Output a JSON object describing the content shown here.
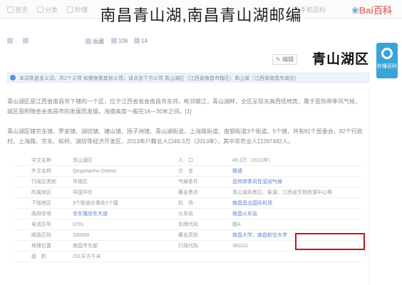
{
  "overlay_title": "南昌青山湖,南昌青山湖邮编",
  "topbar": {
    "items": [
      "首页",
      "分类",
      "秒懂",
      "特色",
      "用户",
      "权威合作",
      "手机百科"
    ],
    "logo": "Bai百科"
  },
  "subbar": {
    "items": [
      "收藏",
      "106",
      "14"
    ]
  },
  "float_button": {
    "label": "秒懂百科"
  },
  "entry": {
    "title": "青山湖区",
    "edit_label": "编辑"
  },
  "notice": {
    "text": "本词条是多义词，共2个义项 如需查看其他义项，请点击下方义项 青山湖区（江西省南昌市辖区）青山湖（江西省南昌市湖泊）"
  },
  "paragraphs": [
    {
      "text": "青山湖区是江西省南昌市下辖的一个区，位于江西省省会南昌市东郊，毗邻赣江，青山湖畔，全区呈现东高西低地势，属于亚热带季风气候，城区面积随省会南昌市的发展而发展，海拔高度一般在16—30米之间。[1]"
    },
    {
      "text": "青山湖区辖京东镇、罗家镇、湖坊镇、塘山镇、扬子洲镇、青山湖街道、上海路街道、南钢街道3个街道、5个镇，共有81个居委会，82个行政村。上海路、京东、蛟桥、湖坊等经济开发区，2013年户籍总人口49.3万（2013年），其中非农业人口267482人。"
    }
  ],
  "table": {
    "rows": [
      [
        "中文名称",
        "青山湖区",
        "人　口",
        "49.3万（2013年）"
      ],
      [
        "外文名称",
        "Qingshanhu District",
        "方　言",
        "赣语"
      ],
      [
        "行政区类别",
        "市辖区",
        "气候条件",
        "亚热带季风性湿润气候"
      ],
      [
        "所属地区",
        "中国华东",
        "著名景点",
        "青山湖风景区、象湖、江西省生物资源中心等"
      ],
      [
        "下辖地区",
        "3个街道办事处5个镇",
        "机　场",
        "南昌昌北国际机场"
      ],
      [
        "政府驻地",
        "京东镇京东大道",
        "火车站",
        "南昌火车站"
      ],
      [
        "电话区号",
        "0791",
        "车牌代码",
        "赣A"
      ],
      [
        "邮政区码",
        "330000",
        "著名高校",
        "南昌大学、南昌航空大学"
      ],
      [
        "地理位置",
        "南昌市东部",
        "行政代码",
        "360111"
      ],
      [
        "面　积",
        "231平方千米",
        "",
        ""
      ]
    ]
  }
}
